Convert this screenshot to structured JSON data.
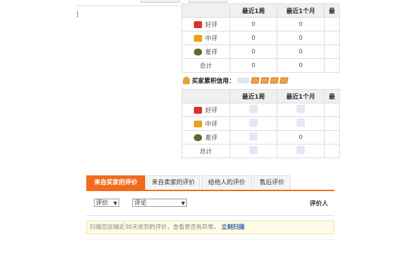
{
  "top_fragment": "]",
  "table_headers": [
    "最近1周",
    "最近1个月",
    "最"
  ],
  "seller_table": {
    "rows": [
      {
        "label": "好评",
        "icon": "flower-red-icon",
        "week": "0",
        "month": "0"
      },
      {
        "label": "中评",
        "icon": "flower-yellow-icon",
        "week": "0",
        "month": "0"
      },
      {
        "label": "差评",
        "icon": "wilted-plant-icon",
        "week": "0",
        "month": "0"
      },
      {
        "label": "总计",
        "icon": "",
        "week": "0",
        "month": "0"
      }
    ]
  },
  "buyer_credit": {
    "label": "买家累积信用："
  },
  "buyer_table": {
    "rows": [
      {
        "label": "好评",
        "icon": "flower-red-icon",
        "week": "",
        "month": ""
      },
      {
        "label": "中评",
        "icon": "flower-yellow-icon",
        "week": "",
        "month": ""
      },
      {
        "label": "差评",
        "icon": "wilted-plant-icon",
        "week": "",
        "month": "0"
      },
      {
        "label": "总计",
        "icon": "",
        "week": "",
        "month": ""
      }
    ]
  },
  "tabs": [
    {
      "label": "来自买家的评价",
      "active": true
    },
    {
      "label": "来自卖家的评价",
      "active": false
    },
    {
      "label": "给他人的评价",
      "active": false
    },
    {
      "label": "售后评价",
      "active": false
    }
  ],
  "filters": {
    "rating": "评价",
    "comment": "评论",
    "reviewer_header": "评价人"
  },
  "notice": {
    "text": "扫描您店铺近30天收到的评价，查看是否有异常。",
    "link": "立刻扫描"
  },
  "colors": {
    "accent": "#f26b1d",
    "link": "#2a5aa8"
  }
}
